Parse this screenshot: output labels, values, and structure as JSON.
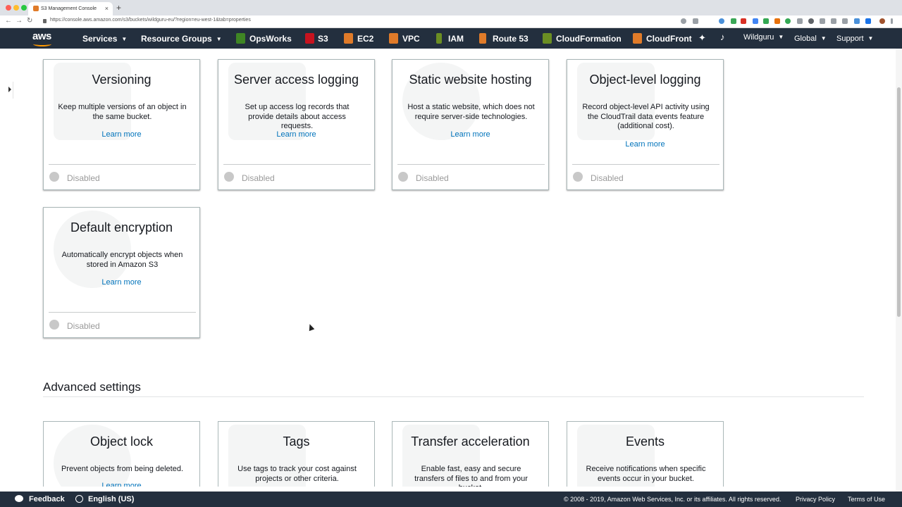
{
  "browser": {
    "tab_title": "S3 Management Console",
    "tab_close": "×",
    "new_tab": "+",
    "url": "https://console.aws.amazon.com/s3/buckets/wildguru-eu/?region=eu-west-1&tab=properties",
    "back": "←",
    "forward": "→",
    "reload": "↻"
  },
  "topnav": {
    "logo": "aws",
    "services": "Services",
    "resource_groups": "Resource Groups",
    "shortcuts": [
      {
        "label": "OpsWorks",
        "icon": "opsworks-icon",
        "color": "#3f8624"
      },
      {
        "label": "S3",
        "icon": "s3-icon",
        "color": "#c7131f"
      },
      {
        "label": "EC2",
        "icon": "ec2-icon",
        "color": "#e07b29"
      },
      {
        "label": "VPC",
        "icon": "vpc-icon",
        "color": "#e07b29"
      },
      {
        "label": "IAM",
        "icon": "iam-icon",
        "color": "#6b8e23"
      },
      {
        "label": "Route 53",
        "icon": "route53-icon",
        "color": "#e07b29"
      },
      {
        "label": "CloudFormation",
        "icon": "cloudformation-icon",
        "color": "#6b8e23"
      },
      {
        "label": "CloudFront",
        "icon": "cloudfront-icon",
        "color": "#e07b29"
      }
    ],
    "account": "Wildguru",
    "region": "Global",
    "support": "Support",
    "caret": "▼"
  },
  "properties": {
    "learn_more": "Learn more",
    "cards": [
      {
        "title": "Versioning",
        "description": "Keep multiple versions of an object in the same bucket.",
        "status": "Disabled"
      },
      {
        "title": "Server access logging",
        "description": "Set up access log records that provide details about access requests.",
        "status": "Disabled"
      },
      {
        "title": "Static website hosting",
        "description": "Host a static website, which does not require server-side technologies.",
        "status": "Disabled"
      },
      {
        "title": "Object-level logging",
        "description": "Record object-level API activity using the CloudTrail data events feature (additional cost).",
        "status": "Disabled"
      },
      {
        "title": "Default encryption",
        "description": "Automatically encrypt objects when stored in Amazon S3",
        "status": "Disabled"
      }
    ]
  },
  "advanced": {
    "title": "Advanced settings",
    "cards": [
      {
        "title": "Object lock",
        "description": "Prevent objects from being deleted."
      },
      {
        "title": "Tags",
        "description": "Use tags to track your cost against projects or other criteria."
      },
      {
        "title": "Transfer acceleration",
        "description": "Enable fast, easy and secure transfers of files to and from your bucket."
      },
      {
        "title": "Events",
        "description": "Receive notifications when specific events occur in your bucket."
      }
    ]
  },
  "footer": {
    "feedback": "Feedback",
    "language": "English (US)",
    "copyright": "© 2008 - 2019, Amazon Web Services, Inc. or its affiliates. All rights reserved.",
    "privacy": "Privacy Policy",
    "terms": "Terms of Use"
  }
}
